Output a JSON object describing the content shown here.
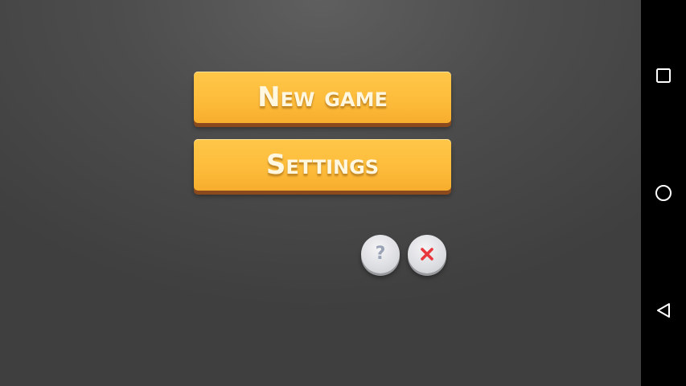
{
  "menu": {
    "new_game_label": "New game",
    "settings_label": "Settings"
  },
  "round_buttons": {
    "help_glyph": "?",
    "help_icon": "question-icon",
    "close_icon": "close-icon"
  },
  "navbar": {
    "recents_icon": "square-icon",
    "home_icon": "circle-icon",
    "back_icon": "triangle-back-icon"
  },
  "colors": {
    "button_yellow": "#fdbb3a",
    "button_shadow": "#8a4a1d",
    "label_text": "#fff7e0",
    "close_red": "#e8383d",
    "background": "#4d4d4d",
    "navbar": "#000000"
  }
}
